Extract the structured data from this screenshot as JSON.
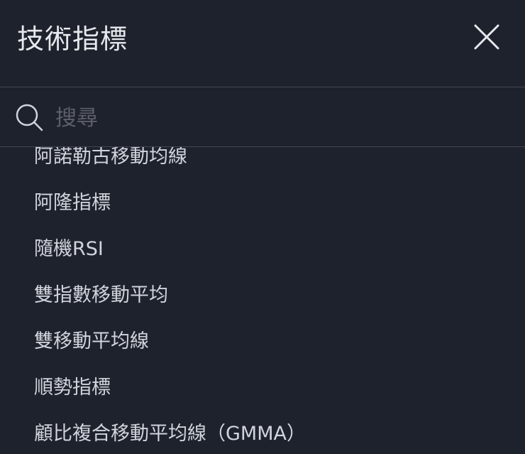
{
  "header": {
    "title": "技術指標",
    "close_icon": "close-icon"
  },
  "search": {
    "placeholder": "搜尋",
    "value": "",
    "icon": "search-icon"
  },
  "indicators": [
    "阿諾勒古移動均線",
    "阿隆指標",
    "隨機RSI",
    "雙指數移動平均",
    "雙移動平均線",
    "順勢指標",
    "顧比複合移動平均線（GMMA）"
  ],
  "colors": {
    "background": "#1e222d",
    "divider": "#434651",
    "text_primary": "#e6e8ec",
    "text_item": "#d1d4dc",
    "placeholder": "#5d606b"
  }
}
